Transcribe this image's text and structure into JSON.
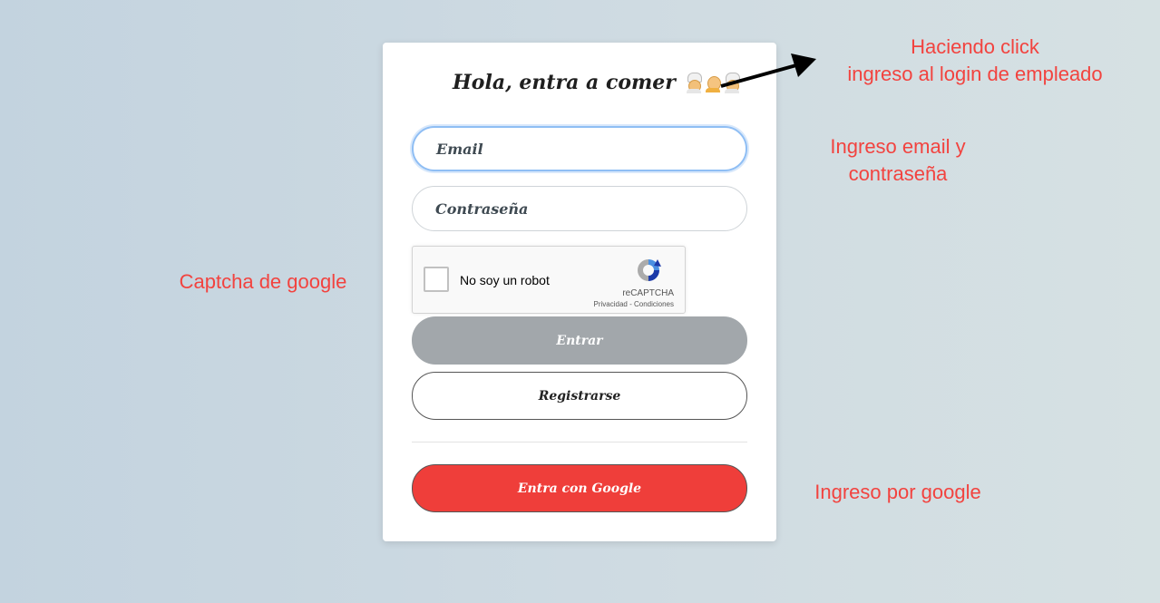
{
  "form": {
    "title": "Hola, entra a comer",
    "title_icons": [
      "chef-icon",
      "chef-icon",
      "chef-icon"
    ],
    "email_placeholder": "Email",
    "password_placeholder": "Contraseña",
    "captcha": {
      "label": "No soy un robot",
      "brand": "reCAPTCHA",
      "links": "Privacidad - Condiciones"
    },
    "enter_label": "Entrar",
    "register_label": "Registrarse",
    "google_label": "Entra con Google"
  },
  "annotations": {
    "employee_login": [
      "Haciendo click",
      "ingreso al login de empleado"
    ],
    "credentials": [
      "Ingreso email y",
      "contraseña"
    ],
    "captcha": "Captcha de google",
    "google": "Ingreso por google"
  },
  "colors": {
    "annotation": "#f2433f",
    "google_button": "#ef3e3a",
    "enter_button": "#a2a7ab",
    "email_focus": "#8fbef4"
  }
}
